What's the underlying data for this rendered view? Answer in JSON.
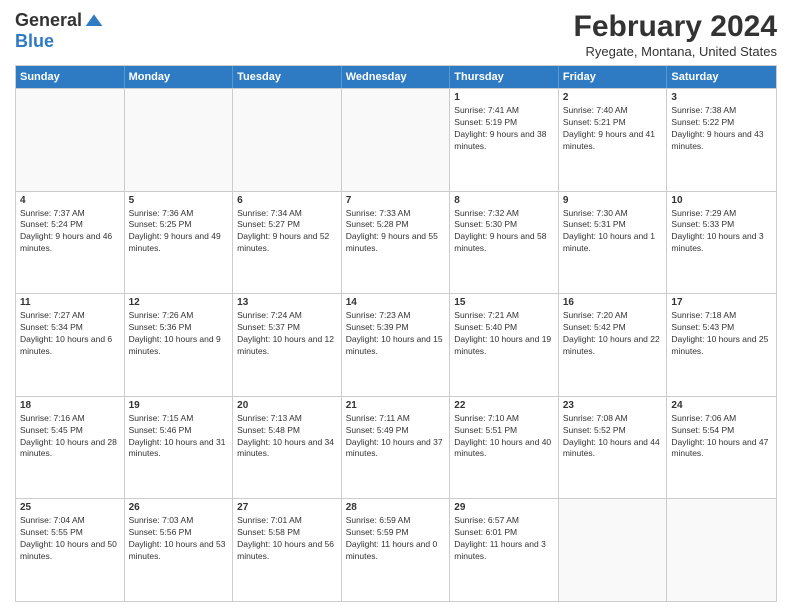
{
  "logo": {
    "general": "General",
    "blue": "Blue"
  },
  "header": {
    "month": "February 2024",
    "location": "Ryegate, Montana, United States"
  },
  "days": [
    "Sunday",
    "Monday",
    "Tuesday",
    "Wednesday",
    "Thursday",
    "Friday",
    "Saturday"
  ],
  "weeks": [
    [
      {
        "day": "",
        "empty": true
      },
      {
        "day": "",
        "empty": true
      },
      {
        "day": "",
        "empty": true
      },
      {
        "day": "",
        "empty": true
      },
      {
        "day": "1",
        "sunrise": "7:41 AM",
        "sunset": "5:19 PM",
        "daylight": "9 hours and 38 minutes."
      },
      {
        "day": "2",
        "sunrise": "7:40 AM",
        "sunset": "5:21 PM",
        "daylight": "9 hours and 41 minutes."
      },
      {
        "day": "3",
        "sunrise": "7:38 AM",
        "sunset": "5:22 PM",
        "daylight": "9 hours and 43 minutes."
      }
    ],
    [
      {
        "day": "4",
        "sunrise": "7:37 AM",
        "sunset": "5:24 PM",
        "daylight": "9 hours and 46 minutes."
      },
      {
        "day": "5",
        "sunrise": "7:36 AM",
        "sunset": "5:25 PM",
        "daylight": "9 hours and 49 minutes."
      },
      {
        "day": "6",
        "sunrise": "7:34 AM",
        "sunset": "5:27 PM",
        "daylight": "9 hours and 52 minutes."
      },
      {
        "day": "7",
        "sunrise": "7:33 AM",
        "sunset": "5:28 PM",
        "daylight": "9 hours and 55 minutes."
      },
      {
        "day": "8",
        "sunrise": "7:32 AM",
        "sunset": "5:30 PM",
        "daylight": "9 hours and 58 minutes."
      },
      {
        "day": "9",
        "sunrise": "7:30 AM",
        "sunset": "5:31 PM",
        "daylight": "10 hours and 1 minute."
      },
      {
        "day": "10",
        "sunrise": "7:29 AM",
        "sunset": "5:33 PM",
        "daylight": "10 hours and 3 minutes."
      }
    ],
    [
      {
        "day": "11",
        "sunrise": "7:27 AM",
        "sunset": "5:34 PM",
        "daylight": "10 hours and 6 minutes."
      },
      {
        "day": "12",
        "sunrise": "7:26 AM",
        "sunset": "5:36 PM",
        "daylight": "10 hours and 9 minutes."
      },
      {
        "day": "13",
        "sunrise": "7:24 AM",
        "sunset": "5:37 PM",
        "daylight": "10 hours and 12 minutes."
      },
      {
        "day": "14",
        "sunrise": "7:23 AM",
        "sunset": "5:39 PM",
        "daylight": "10 hours and 15 minutes."
      },
      {
        "day": "15",
        "sunrise": "7:21 AM",
        "sunset": "5:40 PM",
        "daylight": "10 hours and 19 minutes."
      },
      {
        "day": "16",
        "sunrise": "7:20 AM",
        "sunset": "5:42 PM",
        "daylight": "10 hours and 22 minutes."
      },
      {
        "day": "17",
        "sunrise": "7:18 AM",
        "sunset": "5:43 PM",
        "daylight": "10 hours and 25 minutes."
      }
    ],
    [
      {
        "day": "18",
        "sunrise": "7:16 AM",
        "sunset": "5:45 PM",
        "daylight": "10 hours and 28 minutes."
      },
      {
        "day": "19",
        "sunrise": "7:15 AM",
        "sunset": "5:46 PM",
        "daylight": "10 hours and 31 minutes."
      },
      {
        "day": "20",
        "sunrise": "7:13 AM",
        "sunset": "5:48 PM",
        "daylight": "10 hours and 34 minutes."
      },
      {
        "day": "21",
        "sunrise": "7:11 AM",
        "sunset": "5:49 PM",
        "daylight": "10 hours and 37 minutes."
      },
      {
        "day": "22",
        "sunrise": "7:10 AM",
        "sunset": "5:51 PM",
        "daylight": "10 hours and 40 minutes."
      },
      {
        "day": "23",
        "sunrise": "7:08 AM",
        "sunset": "5:52 PM",
        "daylight": "10 hours and 44 minutes."
      },
      {
        "day": "24",
        "sunrise": "7:06 AM",
        "sunset": "5:54 PM",
        "daylight": "10 hours and 47 minutes."
      }
    ],
    [
      {
        "day": "25",
        "sunrise": "7:04 AM",
        "sunset": "5:55 PM",
        "daylight": "10 hours and 50 minutes."
      },
      {
        "day": "26",
        "sunrise": "7:03 AM",
        "sunset": "5:56 PM",
        "daylight": "10 hours and 53 minutes."
      },
      {
        "day": "27",
        "sunrise": "7:01 AM",
        "sunset": "5:58 PM",
        "daylight": "10 hours and 56 minutes."
      },
      {
        "day": "28",
        "sunrise": "6:59 AM",
        "sunset": "5:59 PM",
        "daylight": "11 hours and 0 minutes."
      },
      {
        "day": "29",
        "sunrise": "6:57 AM",
        "sunset": "6:01 PM",
        "daylight": "11 hours and 3 minutes."
      },
      {
        "day": "",
        "empty": true
      },
      {
        "day": "",
        "empty": true
      }
    ]
  ],
  "labels": {
    "sunrise": "Sunrise:",
    "sunset": "Sunset:",
    "daylight": "Daylight:"
  }
}
